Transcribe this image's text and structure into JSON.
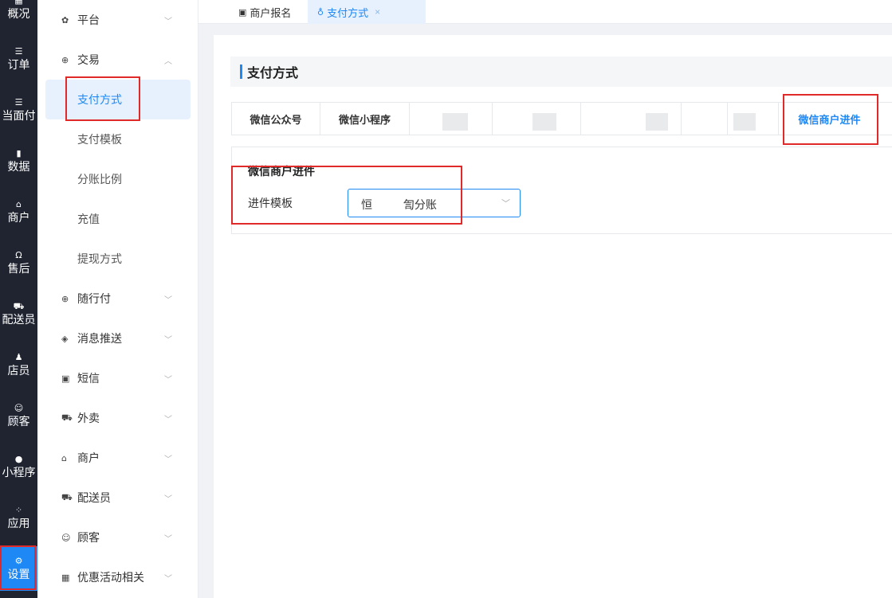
{
  "rail": {
    "items": [
      {
        "icon": "dashboard-icon",
        "glyph": "▦",
        "label": "概况"
      },
      {
        "icon": "list-icon",
        "glyph": "☰",
        "label": "订单"
      },
      {
        "icon": "list-icon",
        "glyph": "☰",
        "label": "当面付"
      },
      {
        "icon": "bar-chart-icon",
        "glyph": "▮",
        "label": "数据"
      },
      {
        "icon": "store-icon",
        "glyph": "⌂",
        "label": "商户"
      },
      {
        "icon": "headset-icon",
        "glyph": "Ω",
        "label": "售后"
      },
      {
        "icon": "delivery-icon",
        "glyph": "⛟",
        "label": "配送员"
      },
      {
        "icon": "users-icon",
        "glyph": "♟",
        "label": "店员"
      },
      {
        "icon": "customer-icon",
        "glyph": "☺",
        "label": "顾客"
      },
      {
        "icon": "wechat-icon",
        "glyph": "●",
        "label": "小程序"
      },
      {
        "icon": "apps-icon",
        "glyph": "⁘",
        "label": "应用"
      },
      {
        "icon": "settings-user-icon",
        "glyph": "⚙",
        "label": "设置"
      }
    ]
  },
  "menu": {
    "platform": {
      "icon": "gear-icon",
      "glyph": "✿",
      "label": "平台"
    },
    "trade": {
      "icon": "trade-icon",
      "glyph": "⊕",
      "label": "交易"
    },
    "trade_sub": [
      "支付方式",
      "支付模板",
      "分账比例",
      "充值",
      "提现方式"
    ],
    "others": [
      {
        "icon": "pay-icon",
        "glyph": "⊕",
        "label": "随行付"
      },
      {
        "icon": "message-icon",
        "glyph": "◈",
        "label": "消息推送"
      },
      {
        "icon": "sms-icon",
        "glyph": "▣",
        "label": "短信"
      },
      {
        "icon": "takeout-icon",
        "glyph": "⛟",
        "label": "外卖"
      },
      {
        "icon": "store-icon",
        "glyph": "⌂",
        "label": "商户"
      },
      {
        "icon": "delivery-icon",
        "glyph": "⛟",
        "label": "配送员"
      },
      {
        "icon": "customer-icon",
        "glyph": "☺",
        "label": "顾客"
      },
      {
        "icon": "gift-icon",
        "glyph": "▦",
        "label": "优惠活动相关"
      }
    ],
    "chev_down": "﹀",
    "chev_up": "︿"
  },
  "tabs": [
    {
      "icon": "merchant-signup-icon",
      "glyph": "▣",
      "label": "商户报名"
    },
    {
      "icon": "payment-method-icon",
      "glyph": "♁",
      "label": "支付方式",
      "close": "×"
    }
  ],
  "content": {
    "section_title": "支付方式",
    "subtabs": [
      "微信公众号",
      "微信小程序",
      "微信商户进件"
    ],
    "config": {
      "title": "微信商户进件",
      "field_label": "进件模板",
      "select_value": "恒          訇分账",
      "arrow": "﹀"
    }
  },
  "colors": {
    "accent": "#1e88f5",
    "rail_bg": "#1f2430",
    "highlight_red": "#e02a2a"
  }
}
